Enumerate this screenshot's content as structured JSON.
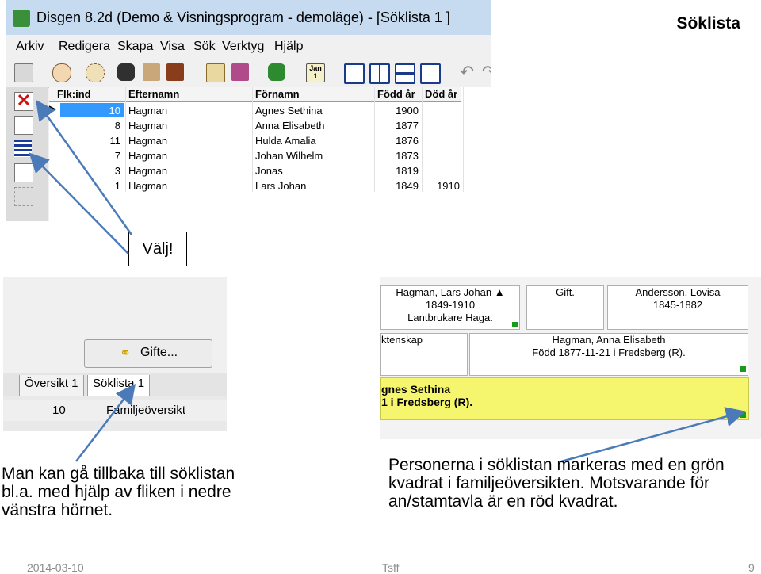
{
  "slide": {
    "title": "Söklista"
  },
  "window": {
    "title": "Disgen 8.2d (Demo & Visningsprogram - demoläge) - [Söklista 1 ]",
    "menu": [
      "Arkiv",
      "Redigera",
      "Skapa",
      "Visa",
      "Sök",
      "Verktyg",
      "Hjälp"
    ],
    "calendar_icon_text": "Jan\n1"
  },
  "grid": {
    "columns": [
      "Flk:ind",
      "Efternamn",
      "Förnamn",
      "Född år",
      "Död år"
    ],
    "rows": [
      {
        "id": "10",
        "surname": "Hagman",
        "firstname": "Agnes Sethina",
        "born": "1900",
        "died": ""
      },
      {
        "id": "8",
        "surname": "Hagman",
        "firstname": "Anna Elisabeth",
        "born": "1877",
        "died": ""
      },
      {
        "id": "11",
        "surname": "Hagman",
        "firstname": "Hulda Amalia",
        "born": "1876",
        "died": ""
      },
      {
        "id": "7",
        "surname": "Hagman",
        "firstname": "Johan Wilhelm",
        "born": "1873",
        "died": ""
      },
      {
        "id": "3",
        "surname": "Hagman",
        "firstname": "Jonas",
        "born": "1819",
        "died": ""
      },
      {
        "id": "1",
        "surname": "Hagman",
        "firstname": "Lars Johan",
        "born": "1849",
        "died": "1910"
      }
    ]
  },
  "callout": {
    "text": "Välj!"
  },
  "bottom_left": {
    "gifte_label": "Gifte...",
    "tabs": [
      "Översikt 1",
      "Söklista 1"
    ],
    "status_number": "10",
    "status_text": "Familjeöversikt"
  },
  "family": {
    "person1": {
      "name": "Hagman, Lars Johan ▲",
      "years": "1849-1910",
      "note": "Lantbrukare Haga."
    },
    "marriage": "Gift.",
    "person2": {
      "name": "Andersson, Lovisa",
      "years": "1845-1882"
    },
    "children_label": "ktenskap",
    "child": {
      "name": "Hagman, Anna Elisabeth",
      "born": "Född 1877-11-21 i Fredsberg (R)."
    },
    "selected": {
      "line1": "gnes Sethina",
      "line2": "1 i Fredsberg (R)."
    }
  },
  "captions": {
    "left": "Man kan gå tillbaka till söklistan bl.a. med hjälp av fliken i nedre vänstra hörnet.",
    "right": "Personerna i söklistan markeras med en grön kvadrat i familjeöversikten. Motsvarande för an/stamtavla är en röd kvadrat."
  },
  "footer": {
    "date": "2014-03-10",
    "center": "Tsff",
    "page": "9"
  },
  "colors": {
    "arrow": "#4a7ab8",
    "selection": "#3399ff",
    "highlight": "#f5f56e",
    "marker": "#1a9a1a"
  }
}
